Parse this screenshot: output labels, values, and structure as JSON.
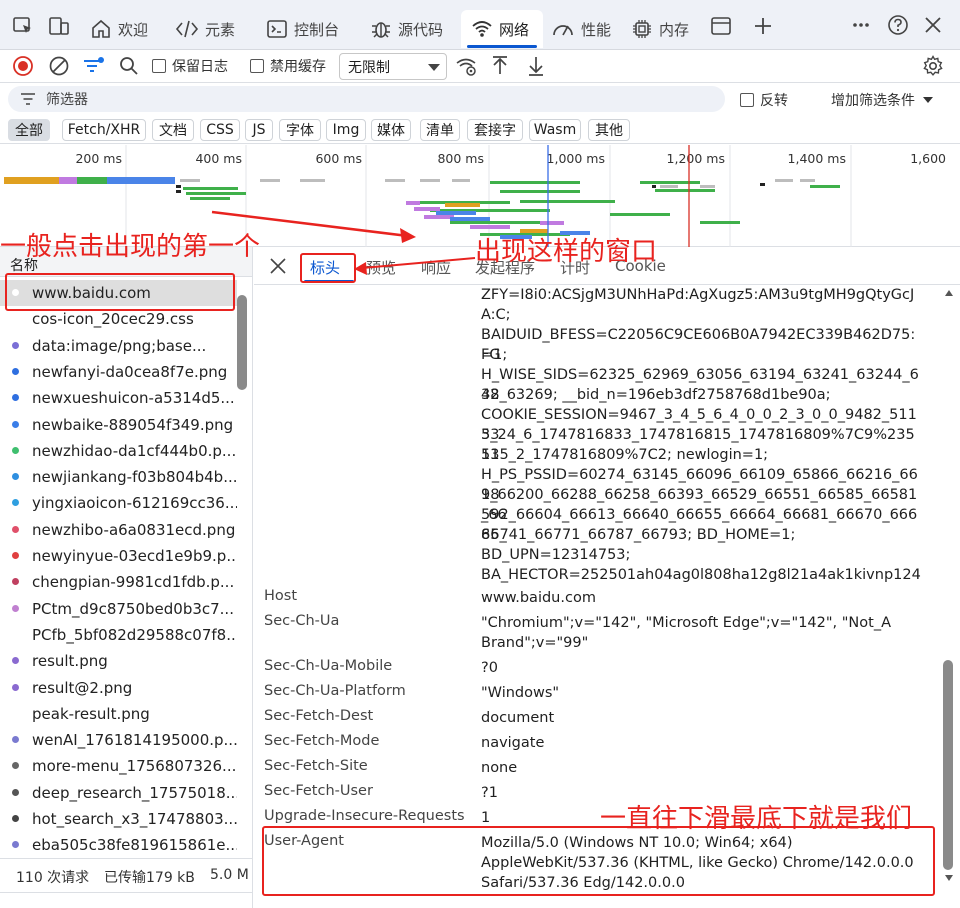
{
  "tabs": {
    "welcome": "欢迎",
    "elements": "元素",
    "console": "控制台",
    "sources": "源代码",
    "network": "网络",
    "performance": "性能",
    "memory": "内存"
  },
  "toolbar": {
    "preserve_log": "保留日志",
    "disable_cache": "禁用缓存",
    "throttle": "无限制"
  },
  "filter": {
    "placeholder": "筛选器",
    "invert": "反转",
    "more_filters": "增加筛选条件"
  },
  "types": [
    "全部",
    "Fetch/XHR",
    "文档",
    "CSS",
    "JS",
    "字体",
    "Img",
    "媒体",
    "清单",
    "套接字",
    "Wasm",
    "其他"
  ],
  "timeline": {
    "ticks": [
      "200 ms",
      "400 ms",
      "600 ms",
      "800 ms",
      "1,000 ms",
      "1,200 ms",
      "1,400 ms",
      "1,600"
    ]
  },
  "requests": {
    "header": "名称",
    "items": [
      {
        "name": "www.baidu.com",
        "color": "#ffffff"
      },
      {
        "name": "cos-icon_20cec29.css",
        "color": "#ffffff"
      },
      {
        "name": "data:image/png;base...",
        "color": "#7b6fd6"
      },
      {
        "name": "newfanyi-da0cea8f7e.png",
        "color": "#2f6fe0"
      },
      {
        "name": "newxueshuicon-a5314d5...",
        "color": "#2f6fe0"
      },
      {
        "name": "newbaike-889054f349.png",
        "color": "#3a7ee8"
      },
      {
        "name": "newzhidao-da1cf444b0.p...",
        "color": "#3fbf6f"
      },
      {
        "name": "newjiankang-f03b804b4b...",
        "color": "#2f8fe0"
      },
      {
        "name": "yingxiaoicon-612169cc36...",
        "color": "#2f9fe0"
      },
      {
        "name": "newzhibo-a6a0831ecd.png",
        "color": "#e0506a"
      },
      {
        "name": "newyinyue-03ecd1e9b9.p...",
        "color": "#e04040"
      },
      {
        "name": "chengpian-9981cd1fdb.p...",
        "color": "#c04060"
      },
      {
        "name": "PCtm_d9c8750bed0b3c7...",
        "color": "#c080d0"
      },
      {
        "name": "PCfb_5bf082d29588c07f8...",
        "color": "#ffffff"
      },
      {
        "name": "result.png",
        "color": "#8a6ad0"
      },
      {
        "name": "result@2.png",
        "color": "#8a6ad0"
      },
      {
        "name": "peak-result.png",
        "color": "#ffffff"
      },
      {
        "name": "wenAI_1761814195000.p...",
        "color": "#7a7ad0"
      },
      {
        "name": "more-menu_1756807326...",
        "color": "#666666"
      },
      {
        "name": "deep_research_17575018...",
        "color": "#555555"
      },
      {
        "name": "hot_search_x3_17478803...",
        "color": "#444444"
      },
      {
        "name": "eba505c38fe819615861e...",
        "color": "#7a7ad0"
      }
    ]
  },
  "status": {
    "requests": "110 次请求",
    "transferred": "已传输179 kB",
    "resources": "5.0 M"
  },
  "detail_tabs": {
    "headers": "标头",
    "preview": "预览",
    "response": "响应",
    "initiator": "发起程序",
    "timing": "计时",
    "cookies": "Cookie"
  },
  "headers": {
    "cookie_lines": [
      "ZFY=I8i0:ACSjgM3UNhHaPd:AgXugz5:AM3u9tgMH9gQtyGcJ",
      "A:C;",
      "BAIDUID_BFESS=C22056C9CE606B0A7942EC339B462D75:FG",
      "=1;",
      "H_WISE_SIDS=62325_62969_63056_63194_63241_63244_632",
      "48_63269; __bid_n=196eb3df2758768d1be90a;",
      "COOKIE_SESSION=9467_3_4_5_6_4_0_0_2_3_0_0_9482_51153",
      "3_24_6_1747816833_1747816815_1747816809%7C9%23511",
      "535_2_1747816809%7C2; newlogin=1;",
      "H_PS_PSSID=60274_63145_66096_66109_65866_66216_6618",
      "9_66200_66288_66258_66393_66529_66551_66585_66581_66",
      "592_66604_66613_66640_66655_66664_66681_66670_66685_",
      "66741_66771_66787_66793; BD_HOME=1;",
      "BD_UPN=12314753;",
      "BA_HECTOR=252501ah04ag0l808ha12g8l21a4ak1kivnp124"
    ],
    "rows": [
      {
        "name": "Host",
        "value": "www.baidu.com"
      },
      {
        "name": "Sec-Ch-Ua",
        "value": "\"Chromium\";v=\"142\", \"Microsoft Edge\";v=\"142\", \"Not_A"
      },
      {
        "name": "",
        "value": "Brand\";v=\"99\""
      },
      {
        "name": "Sec-Ch-Ua-Mobile",
        "value": "?0"
      },
      {
        "name": "Sec-Ch-Ua-Platform",
        "value": "\"Windows\""
      },
      {
        "name": "Sec-Fetch-Dest",
        "value": "document"
      },
      {
        "name": "Sec-Fetch-Mode",
        "value": "navigate"
      },
      {
        "name": "Sec-Fetch-Site",
        "value": "none"
      },
      {
        "name": "Sec-Fetch-User",
        "value": "?1"
      },
      {
        "name": "Upgrade-Insecure-Requests",
        "value": "1"
      },
      {
        "name": "User-Agent",
        "value": "Mozilla/5.0 (Windows NT 10.0; Win64; x64)"
      },
      {
        "name": "",
        "value": "AppleWebKit/537.36 (KHTML, like Gecko) Chrome/142.0.0.0"
      },
      {
        "name": "",
        "value": "Safari/537.36 Edg/142.0.0.0"
      }
    ]
  },
  "annotations": {
    "first": "一般点击出现的第一个",
    "window": "出现这样的窗口",
    "scroll": "一直往下滑最底下就是我们"
  },
  "colors": {
    "accent": "#0b57d0",
    "annotation": "#e8231f",
    "record": "#d93025"
  }
}
